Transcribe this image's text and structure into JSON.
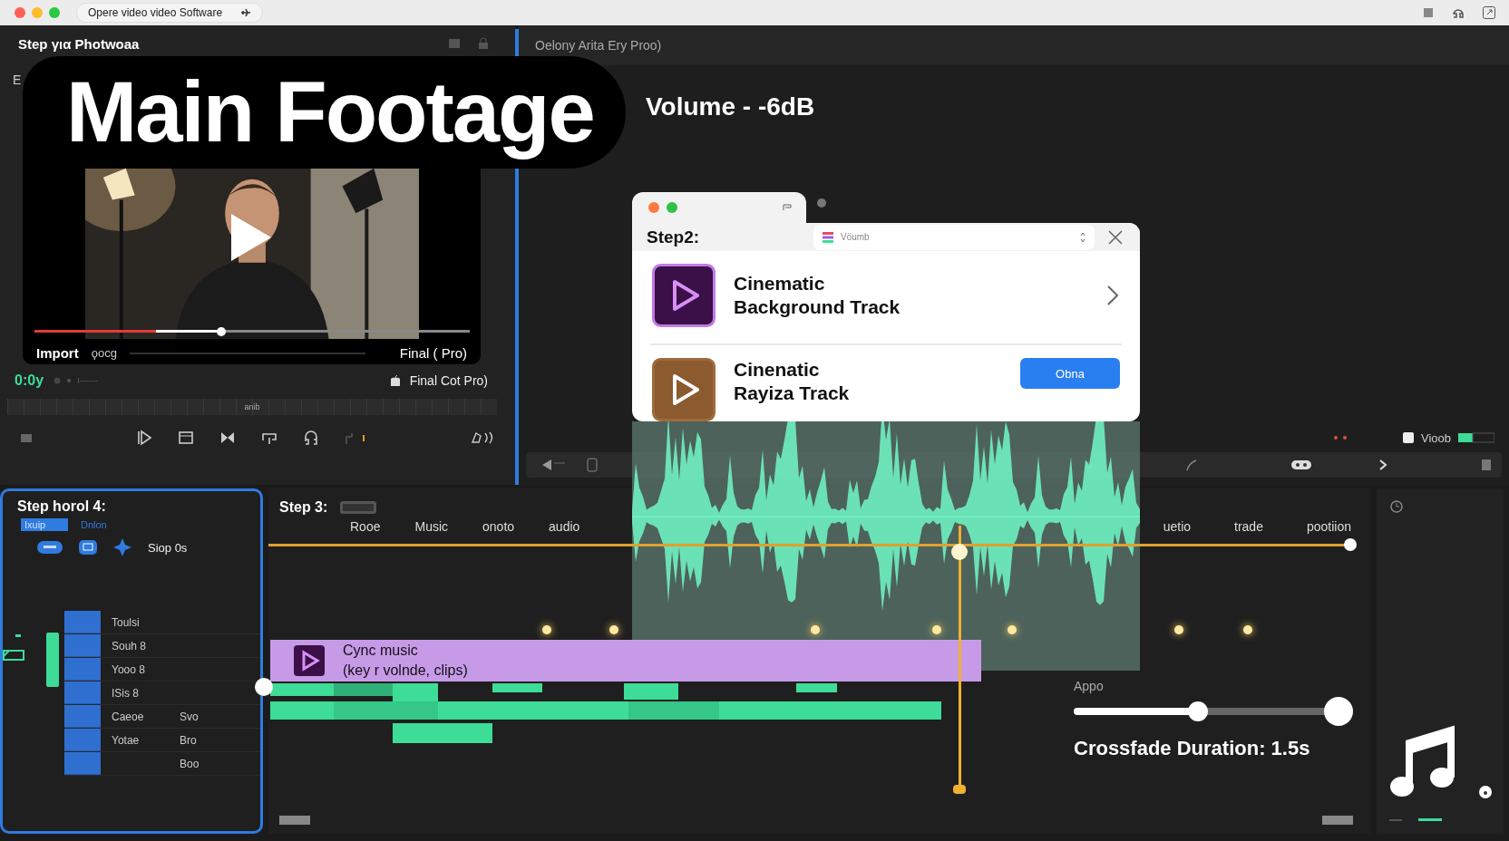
{
  "window": {
    "title": "Opere video video Software"
  },
  "source_panel": {
    "title": "Step για Photwoaa",
    "side_label": "E",
    "overlay_title": "Main Footage",
    "progress": {
      "level": 0.28
    },
    "scrubber": {
      "level": 0.43
    },
    "import_label": "Import",
    "format_label": "ϙocg",
    "output_label": "Final ( Pro)",
    "timecode": "0:0y",
    "app_label": "Final Cot Pro)",
    "ruler_label": "anib"
  },
  "viewer": {
    "title": "Oelony Arita Ery Proo)",
    "volume_label": "Volume - -6dB",
    "meter_label": "Vioob",
    "dialog": {
      "title": "Step2:",
      "search": {
        "placeholder": "Vöumb"
      },
      "items": [
        {
          "title": "Cinematic",
          "subtitle": "Background Track",
          "color": "#3b0f47"
        },
        {
          "title": "Cinenatic",
          "subtitle": "Rayiza Track",
          "color": "#8b5a2e",
          "button": "Obna"
        }
      ]
    }
  },
  "inspector": {
    "title": "Step horol 4:",
    "tabs": [
      {
        "label": "Ixuip",
        "selected": true
      },
      {
        "label": "Dnlon",
        "selected": false
      }
    ],
    "tools_label": "Siop  0s",
    "rows": [
      {
        "label": "Toulsi"
      },
      {
        "label": "Souh 8"
      },
      {
        "label": "Yooo 8"
      },
      {
        "label": "ISis 8"
      },
      {
        "label": "Caeoe",
        "value": "Svo"
      },
      {
        "label": "Yotae",
        "value": "Bro"
      },
      {
        "value": "Boo"
      }
    ]
  },
  "timeline": {
    "title": "Step 3:",
    "labels_left": [
      "Rooe",
      "Music",
      "onoto",
      "audio"
    ],
    "labels_right": [
      "uetio",
      "trade",
      "pootiion"
    ],
    "clip": {
      "title": "Cync music",
      "subtitle": "(key r volnde, clips)"
    },
    "crossfade": {
      "label": "Appo",
      "level": 0.47,
      "caption": "Crossfade Duration: 1.5s"
    }
  }
}
